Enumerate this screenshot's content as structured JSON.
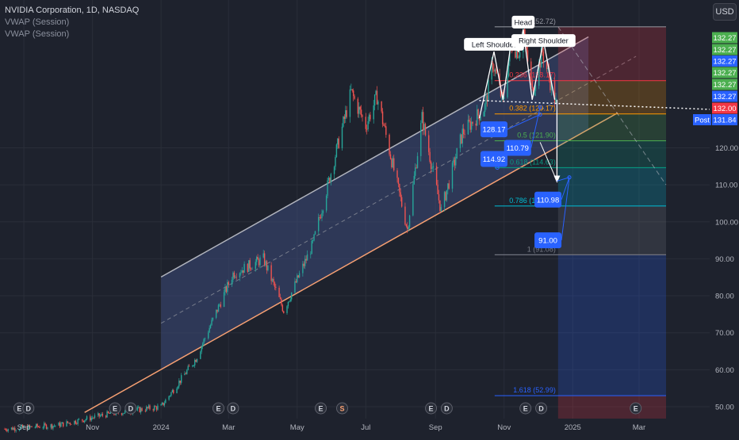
{
  "legend": {
    "title": "NVIDIA Corporation, 1D, NASDAQ",
    "indicators": [
      "VWAP (Session)",
      "VWAP (Session)"
    ]
  },
  "currency_button": "USD",
  "colors": {
    "bg": "#1e222d",
    "grid": "#2a2e39",
    "up": "#26a69a",
    "down": "#ef5350",
    "channel_fill": "#3d4a7a",
    "channel_line": "#b2b5be",
    "support_line": "#f7a072",
    "callout": "#2962ff"
  },
  "chart_data": {
    "type": "candlestick",
    "symbol": "NVDA",
    "interval": "1D",
    "x_axis_labels": [
      "Sep",
      "Nov",
      "2024",
      "Mar",
      "May",
      "Jul",
      "Sep",
      "Nov",
      "2025",
      "Mar"
    ],
    "y_axis_ticks": [
      50.0,
      60.0,
      70.0,
      80.0,
      90.0,
      100.0,
      110.0,
      120.0
    ],
    "ylim": [
      45,
      155
    ],
    "price_path_monthly": [
      {
        "date": "2023-08-15",
        "close": 44
      },
      {
        "date": "2023-10-01",
        "close": 45
      },
      {
        "date": "2023-11-15",
        "close": 48
      },
      {
        "date": "2024-01-01",
        "close": 50
      },
      {
        "date": "2024-02-01",
        "close": 63
      },
      {
        "date": "2024-03-05",
        "close": 86
      },
      {
        "date": "2024-04-01",
        "close": 90
      },
      {
        "date": "2024-04-19",
        "close": 76
      },
      {
        "date": "2024-05-15",
        "close": 94
      },
      {
        "date": "2024-06-18",
        "close": 135
      },
      {
        "date": "2024-07-01",
        "close": 126
      },
      {
        "date": "2024-07-11",
        "close": 134
      },
      {
        "date": "2024-08-07",
        "close": 98
      },
      {
        "date": "2024-08-20",
        "close": 128
      },
      {
        "date": "2024-09-06",
        "close": 103
      },
      {
        "date": "2024-09-25",
        "close": 124
      },
      {
        "date": "2024-10-15",
        "close": 131
      },
      {
        "date": "2024-10-22",
        "close": 143
      },
      {
        "date": "2024-10-31",
        "close": 132
      },
      {
        "date": "2024-11-07",
        "close": 148
      },
      {
        "date": "2024-11-14",
        "close": 146
      },
      {
        "date": "2024-11-18",
        "close": 152
      },
      {
        "date": "2024-11-26",
        "close": 135
      },
      {
        "date": "2024-12-05",
        "close": 146
      },
      {
        "date": "2024-12-18",
        "close": 131
      }
    ],
    "fibonacci": [
      {
        "ratio": "0",
        "price": 152.72,
        "label": "0 (152.72)",
        "color": "#9598a1"
      },
      {
        "ratio": "0.236",
        "price": 138.17,
        "label": "0.236 (138.17)",
        "color": "#f23645"
      },
      {
        "ratio": "0.382",
        "price": 129.17,
        "label": "0.382 (129.17)",
        "color": "#ff9800"
      },
      {
        "ratio": "0.5",
        "price": 121.9,
        "label": "0.5 (121.90)",
        "color": "#4caf50"
      },
      {
        "ratio": "0.618",
        "price": 114.63,
        "label": "0.618 (114.63)",
        "color": "#089981"
      },
      {
        "ratio": "0.786",
        "price": 104.27,
        "label": "0.786 (104.27)",
        "color": "#00bcd4"
      },
      {
        "ratio": "1",
        "price": 91.08,
        "label": "1 (91.08)",
        "color": "#787b86"
      },
      {
        "ratio": "1.618",
        "price": 52.99,
        "label": "1.618 (52.99)",
        "color": "#2962ff"
      }
    ],
    "pattern_labels": [
      {
        "text": "Left Shoulder",
        "date": "2024-10-23",
        "price": 148
      },
      {
        "text": "Head",
        "date": "2024-11-18",
        "price": 154
      },
      {
        "text": "Right Shoulder",
        "date": "2024-12-06",
        "price": 149
      }
    ],
    "price_callouts": [
      {
        "value": "128.17",
        "date": "2024-10-23",
        "price": 125
      },
      {
        "value": "110.79",
        "date": "2024-11-13",
        "price": 120
      },
      {
        "value": "114.92",
        "date": "2024-10-23",
        "price": 117
      },
      {
        "value": "110.98",
        "date": "2024-12-10",
        "price": 106
      },
      {
        "value": "91.00",
        "date": "2024-12-10",
        "price": 95
      }
    ],
    "right_axis_badges": [
      {
        "value": "132.27",
        "color": "#4caf50"
      },
      {
        "value": "132.27",
        "color": "#4caf50"
      },
      {
        "value": "132.27",
        "color": "#2962ff"
      },
      {
        "value": "132.27",
        "color": "#4caf50"
      },
      {
        "value": "132.27",
        "color": "#4caf50"
      },
      {
        "value": "132.27",
        "color": "#2962ff"
      },
      {
        "value": "132.00",
        "color": "#f23645"
      },
      {
        "value": "131.84",
        "color": "#2962ff",
        "label": "Post"
      }
    ],
    "event_markers": [
      {
        "date": "2023-08-28",
        "type": "E"
      },
      {
        "date": "2023-09-05",
        "type": "D"
      },
      {
        "date": "2023-11-21",
        "type": "E"
      },
      {
        "date": "2023-12-05",
        "type": "D"
      },
      {
        "date": "2024-02-21",
        "type": "E"
      },
      {
        "date": "2024-03-05",
        "type": "D"
      },
      {
        "date": "2024-05-22",
        "type": "E"
      },
      {
        "date": "2024-06-10",
        "type": "S"
      },
      {
        "date": "2024-08-28",
        "type": "E"
      },
      {
        "date": "2024-09-11",
        "type": "D"
      },
      {
        "date": "2024-11-20",
        "type": "E"
      },
      {
        "date": "2024-12-04",
        "type": "D"
      },
      {
        "date": "2025-02-26",
        "type": "E"
      }
    ]
  }
}
